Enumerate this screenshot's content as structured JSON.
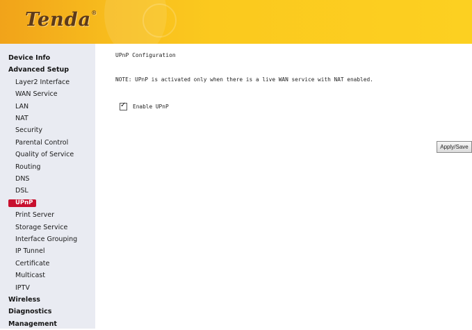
{
  "header": {
    "logo": "Tenda"
  },
  "sidebar": {
    "items": [
      {
        "label": "Device Info",
        "level": "top",
        "active": false
      },
      {
        "label": "Advanced Setup",
        "level": "top",
        "active": false
      },
      {
        "label": "Layer2 Interface",
        "level": "sub",
        "active": false
      },
      {
        "label": "WAN Service",
        "level": "sub",
        "active": false
      },
      {
        "label": "LAN",
        "level": "sub",
        "active": false
      },
      {
        "label": "NAT",
        "level": "sub",
        "active": false
      },
      {
        "label": "Security",
        "level": "sub",
        "active": false
      },
      {
        "label": "Parental Control",
        "level": "sub",
        "active": false
      },
      {
        "label": "Quality of Service",
        "level": "sub",
        "active": false
      },
      {
        "label": "Routing",
        "level": "sub",
        "active": false
      },
      {
        "label": "DNS",
        "level": "sub",
        "active": false
      },
      {
        "label": "DSL",
        "level": "sub",
        "active": false
      },
      {
        "label": "UPnP",
        "level": "sub",
        "active": true
      },
      {
        "label": "Print Server",
        "level": "sub",
        "active": false
      },
      {
        "label": "Storage Service",
        "level": "sub",
        "active": false
      },
      {
        "label": "Interface Grouping",
        "level": "sub",
        "active": false
      },
      {
        "label": "IP Tunnel",
        "level": "sub",
        "active": false
      },
      {
        "label": "Certificate",
        "level": "sub",
        "active": false
      },
      {
        "label": "Multicast",
        "level": "sub",
        "active": false
      },
      {
        "label": "IPTV",
        "level": "sub",
        "active": false
      },
      {
        "label": "Wireless",
        "level": "top",
        "active": false
      },
      {
        "label": "Diagnostics",
        "level": "top",
        "active": false
      },
      {
        "label": "Management",
        "level": "top",
        "active": false
      }
    ]
  },
  "main": {
    "title": "UPnP Configuration",
    "note": "NOTE: UPnP is activated only when there is a live WAN service with NAT enabled.",
    "enable_upnp": {
      "label": "Enable UPnP",
      "checked": true
    },
    "apply_button": "Apply/Save"
  },
  "colors": {
    "header_left": "#f1a31a",
    "header_right": "#fcd021",
    "sidebar_bg": "#e9ebf2",
    "active_bg": "#c8102e",
    "logo": "#5d3a1a"
  }
}
